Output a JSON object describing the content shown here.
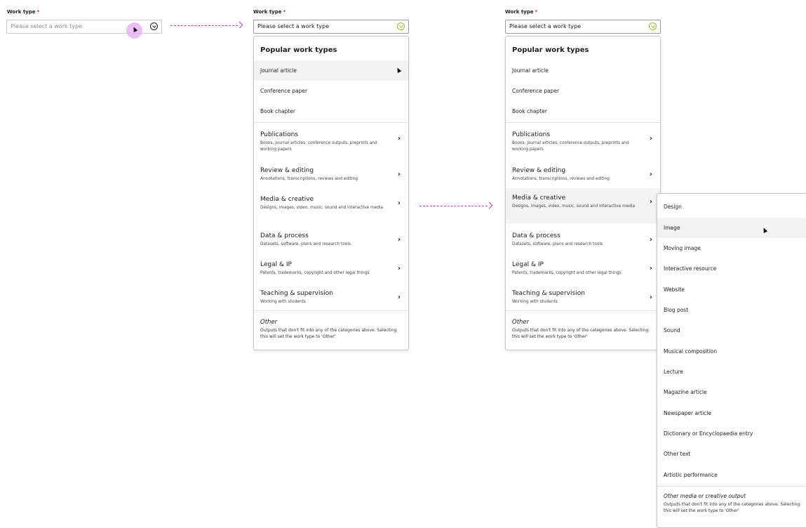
{
  "field": {
    "label": "Work type",
    "required_mark": "*",
    "placeholder": "Please select a work type"
  },
  "menu": {
    "heading": "Popular work types",
    "popular": [
      "Journal article",
      "Conference paper",
      "Book chapter"
    ],
    "categories": [
      {
        "title": "Publications",
        "desc": "Books, journal articles, conference outputs, preprints and working papers"
      },
      {
        "title": "Review & editing",
        "desc": "Annotations, transcriptions, reviews and editing"
      },
      {
        "title": "Media & creative",
        "desc": "Designs, images, video, music, sound and interactive media"
      },
      {
        "title": "Data & process",
        "desc": "Datasets, software, plans and research tools"
      },
      {
        "title": "Legal & IP",
        "desc": "Patents, trademarks, copyright and other legal things"
      },
      {
        "title": "Teaching & supervision",
        "desc": "Working with students"
      }
    ],
    "other": {
      "title": "Other",
      "desc": "Outputs that don't fit into any of the categories above. Selecting this will set the work type to 'Other'"
    },
    "chevron": "›"
  },
  "submenu": {
    "items": [
      "Design",
      "Image",
      "Moving image",
      "Interactive resource",
      "Website",
      "Blog post",
      "Sound",
      "Musical composition",
      "Lecture",
      "Magazine article",
      "Newspaper article",
      "Dictionary or Encyclopaedia entry",
      "Other text",
      "Artistic performance"
    ],
    "other": {
      "title": "Other media or creative output",
      "desc": "Outputs that don't fit into any of the categories above. Selecting this will set the work type to 'Other'"
    }
  },
  "colors": {
    "accent_green": "#8fbf2e",
    "arrow_magenta": "#c43ad3",
    "required_red": "#d6263b"
  }
}
